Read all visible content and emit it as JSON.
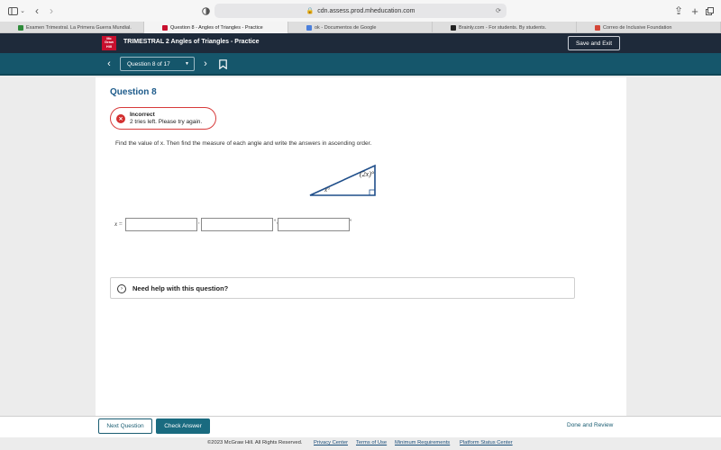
{
  "browser": {
    "url": "cdn.assess.prod.mheducation.com",
    "tabs": [
      {
        "label": "Examen Trimestral. La Primera Guerra Mundial.",
        "color": "#2e8b3a",
        "active": false
      },
      {
        "label": "Question 8 - Angles of Triangles - Practice",
        "color": "#c8102e",
        "active": true
      },
      {
        "label": "ok - Documentos de Google",
        "color": "#4a7fdc",
        "active": false
      },
      {
        "label": "Brainly.com - For students. By students.",
        "color": "#222222",
        "active": false
      },
      {
        "label": "Correo de Inclusive Foundation",
        "color": "#d44638",
        "active": false
      }
    ]
  },
  "app": {
    "logo": "Mc Graw Hill",
    "title": "TRIMESTRAL 2 Angles of Triangles - Practice",
    "save_exit": "Save and Exit",
    "question_selector": "Question 8 of 17"
  },
  "question": {
    "title": "Question 8",
    "feedback_title": "Incorrect",
    "feedback_sub": "2 tries left. Please try again.",
    "prompt": "Find the value of x. Then find the measure of each angle and write the answers in ascending order.",
    "angle_top": "(2x)°",
    "angle_left": "x°",
    "answer_label_var": "x",
    "answer_label_eq": " =",
    "sep1": ",",
    "sep2": "°,",
    "sep3": "°",
    "help": "Need help with this question?"
  },
  "footer": {
    "next": "Next Question",
    "check": "Check Answer",
    "done": "Done and Review"
  },
  "copyright": {
    "text": "©2023 McGraw Hill. All Rights Reserved.",
    "privacy": "Privacy Center",
    "terms": "Terms of Use",
    "minreq": "Minimum Requirements",
    "status": "Platform Status Center"
  }
}
